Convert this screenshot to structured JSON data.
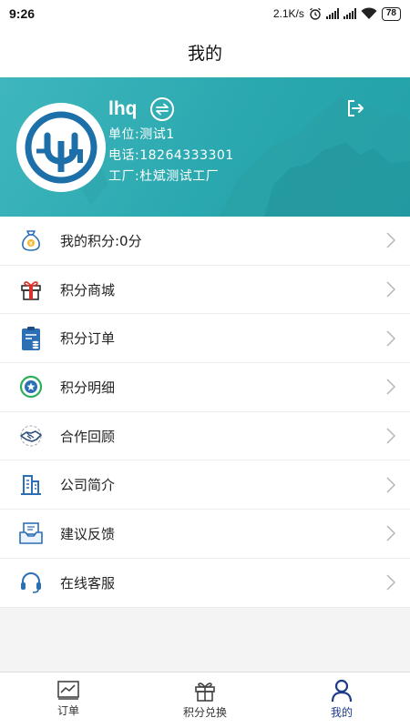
{
  "status_bar": {
    "time": "9:26",
    "speed": "2.1K/s",
    "battery": "78"
  },
  "header": {
    "title": "我的"
  },
  "profile": {
    "name": "lhq",
    "unit_label": "单位:",
    "unit_value": "测试1",
    "phone_label": "电话:",
    "phone_value": "18264333301",
    "factory_label": "工厂:",
    "factory_value": "杜斌测试工厂",
    "accent_color": "#2aa8af"
  },
  "menu": {
    "items": [
      {
        "label": "我的积分:0分",
        "icon": "money-bag-icon"
      },
      {
        "label": "积分商城",
        "icon": "gift-box-icon"
      },
      {
        "label": "积分订单",
        "icon": "clipboard-icon"
      },
      {
        "label": "积分明细",
        "icon": "star-circle-icon"
      },
      {
        "label": "合作回顾",
        "icon": "handshake-icon"
      },
      {
        "label": "公司简介",
        "icon": "building-icon"
      },
      {
        "label": "建议反馈",
        "icon": "inbox-icon"
      },
      {
        "label": "在线客服",
        "icon": "headset-icon"
      }
    ]
  },
  "tabbar": {
    "tabs": [
      {
        "label": "订单",
        "icon": "chart-icon"
      },
      {
        "label": "积分兑换",
        "icon": "gift-icon"
      },
      {
        "label": "我的",
        "icon": "person-icon",
        "active": true
      }
    ],
    "active_color": "#1e3a8a"
  }
}
